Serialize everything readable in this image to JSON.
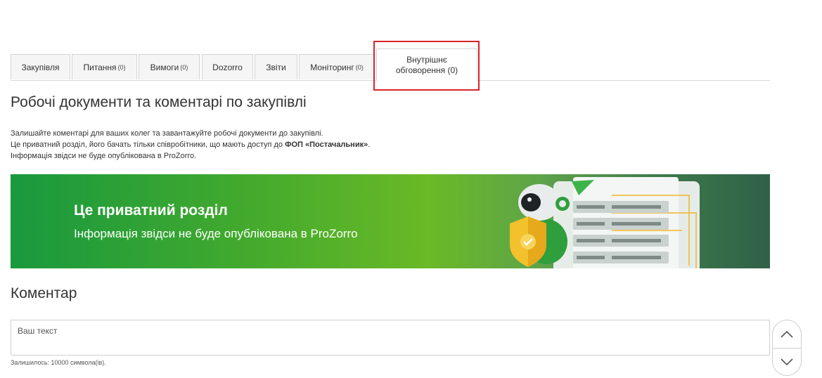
{
  "tabs": [
    {
      "label": "Закупівля",
      "count": ""
    },
    {
      "label": "Питання",
      "count": "(0)"
    },
    {
      "label": "Вимоги",
      "count": "(0)"
    },
    {
      "label": "Dozorro",
      "count": ""
    },
    {
      "label": "Звіти",
      "count": ""
    },
    {
      "label": "Моніторинг",
      "count": "(0)"
    }
  ],
  "active_tab": {
    "line1": "Внутрішнє",
    "line2": "обговорення (0)"
  },
  "page": {
    "title": "Робочі документи та коментарі по закупівлі",
    "info_line1": "Залишайте коментарі для ваших колег та завантажуйте робочі документи до закупівлі.",
    "info_line2_prefix": "Це приватний розділ, його бачать тільки співробітники, що мають доступ до ",
    "info_line2_org": "ФОП «Постачальник»",
    "info_line2_suffix": ".",
    "info_line3": "Інформація звідси не буде опублікована в ProZorro."
  },
  "banner": {
    "title": "Це приватний розділ",
    "subtitle": "Інформація звідси не буде опублікована в ProZorro"
  },
  "comment": {
    "title": "Коментар",
    "placeholder": "Ваш текст",
    "remaining": "Залишилось: 10000 символа(ів)."
  },
  "icons": {
    "scroll_up": "chevron-up-icon",
    "scroll_down": "chevron-down-icon"
  }
}
